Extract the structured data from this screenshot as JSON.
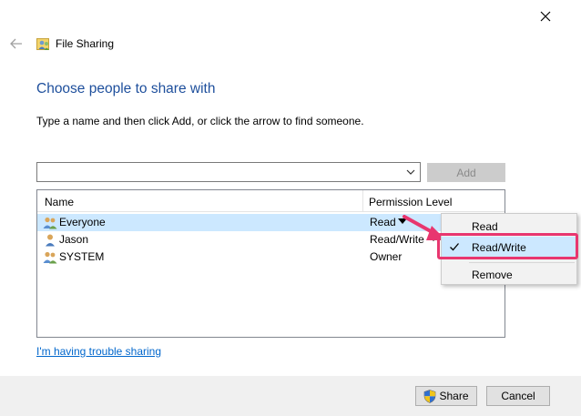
{
  "window": {
    "title": "File Sharing",
    "close_icon": "close-icon",
    "back_icon": "back-arrow-icon"
  },
  "main": {
    "heading": "Choose people to share with",
    "instructions": "Type a name and then click Add, or click the arrow to find someone.",
    "name_input": {
      "value": "",
      "placeholder": ""
    },
    "add_label": "Add",
    "trouble_link": "I'm having trouble sharing"
  },
  "list": {
    "columns": [
      "Name",
      "Permission Level"
    ],
    "rows": [
      {
        "name": "Everyone",
        "permission": "Read",
        "icon": "group-icon",
        "selected": true
      },
      {
        "name": "Jason",
        "permission": "Read/Write",
        "icon": "user-icon",
        "selected": false
      },
      {
        "name": "SYSTEM",
        "permission": "Owner",
        "icon": "group-icon",
        "selected": false
      }
    ]
  },
  "permission_menu": {
    "items": [
      {
        "label": "Read",
        "checked": false
      },
      {
        "label": "Read/Write",
        "checked": true
      },
      {
        "label": "Remove",
        "checked": false
      }
    ]
  },
  "footer": {
    "share_label": "Share",
    "share_icon": "uac-shield-icon",
    "cancel_label": "Cancel"
  },
  "colors": {
    "heading": "#1e4f9c",
    "link": "#0066cc",
    "selection": "#cce8ff",
    "annotation": "#e8366f"
  }
}
